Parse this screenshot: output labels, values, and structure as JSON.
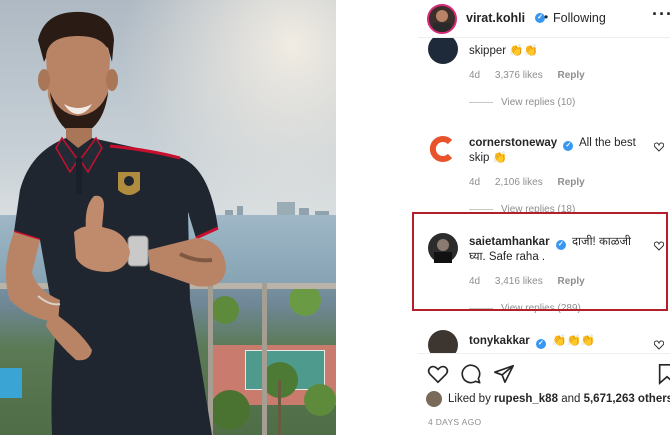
{
  "post_author": {
    "username": "virat.kohli",
    "separator": "•",
    "follow_state": "Following",
    "more_label": "···"
  },
  "comments": [
    {
      "username": "",
      "text": "skipper 👏👏",
      "age": "4d",
      "likes": "3,376 likes",
      "reply_label": "Reply",
      "view_replies": "View replies (10)"
    },
    {
      "username": "cornerstoneway",
      "text": "All the best skip 👏",
      "age": "4d",
      "likes": "2,106 likes",
      "reply_label": "Reply",
      "view_replies": "View replies (18)"
    },
    {
      "username": "saietamhankar",
      "text": "दाजी! काळजी घ्या. Safe raha .",
      "age": "4d",
      "likes": "3,416 likes",
      "reply_label": "Reply",
      "view_replies": "View replies (289)"
    },
    {
      "username": "tonykakkar",
      "text": "👏👏👏",
      "age": "",
      "likes": "",
      "reply_label": "",
      "view_replies": ""
    }
  ],
  "likes_summary": {
    "prefix": "Liked by",
    "user": "rupesh_k88",
    "middle": "and",
    "count": "5,671,263 others"
  },
  "time_ago": "4 DAYS AGO",
  "colors": {
    "highlight_border": "#b3202a",
    "verified_blue": "#3897f0",
    "shirt": "#1f2630",
    "shirt_accent": "#c8102e"
  }
}
